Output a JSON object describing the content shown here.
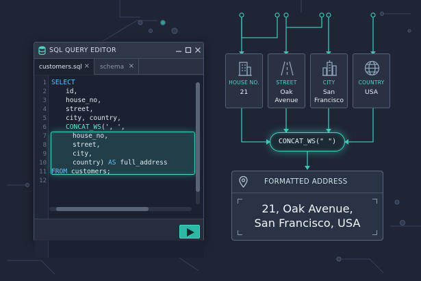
{
  "editor": {
    "title": "SQL QUERY EDITOR",
    "tabs": [
      {
        "label": "customers.sql",
        "close": "×"
      },
      {
        "label": "schema",
        "close": "×"
      }
    ],
    "line_numbers": [
      "1",
      "2",
      "3",
      "4",
      "5",
      "6",
      "7",
      "8",
      "9",
      "10",
      "11",
      "12"
    ],
    "code": {
      "l1": "SELECT",
      "l2": "id,",
      "l3": "house_no,",
      "l4": "street,",
      "l5": "city, country,",
      "l6_fn": "CONCAT_WS",
      "l6_rest": "(', ',",
      "l7": "house_no,",
      "l8": "street,",
      "l9": "city,",
      "l10_a": "country) ",
      "l10_kw": "AS",
      "l10_b": " full_address",
      "l11_kw": "FROM",
      "l11_b": " customers;"
    }
  },
  "columns": [
    {
      "label": "HOUSE NO.",
      "value": "21",
      "icon": "building-icon"
    },
    {
      "label": "STREET",
      "value": "Oak Avenue",
      "icon": "road-icon"
    },
    {
      "label": "CITY",
      "value": "San Francisco",
      "icon": "city-icon"
    },
    {
      "label": "COUNTRY",
      "value": "USA",
      "icon": "globe-icon"
    }
  ],
  "columns_display": {
    "c1": [
      "21"
    ],
    "c2": [
      "Oak",
      "Avenue"
    ],
    "c3": [
      "San",
      "Francisco"
    ],
    "c4": [
      "USA"
    ]
  },
  "concat_label": "CONCAT_WS(\" \")",
  "address": {
    "title": "FORMATTED ADDRESS",
    "line1": "21, Oak Avenue,",
    "line2": "San Francisco, USA"
  },
  "colors": {
    "accent": "#3ed6c3",
    "background": "#1f2535",
    "panel": "#2a3143"
  }
}
